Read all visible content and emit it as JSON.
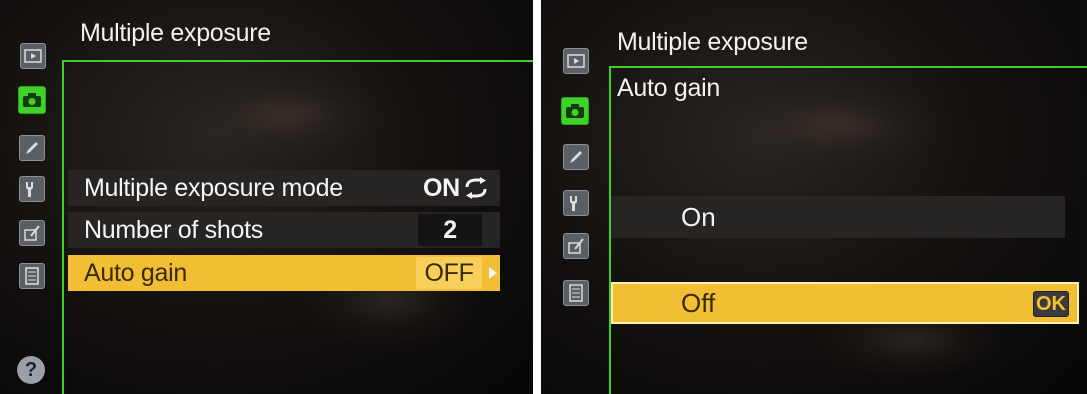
{
  "left_screen": {
    "title": "Multiple exposure",
    "rows": [
      {
        "label": "Multiple exposure mode",
        "value": "ON",
        "value_icon": "repeat-arrows-icon"
      },
      {
        "label": "Number of shots",
        "value": "2"
      },
      {
        "label": "Auto gain",
        "value": "OFF",
        "value_icon": "triangle-right-icon"
      }
    ],
    "sidebar_icons": [
      "playback-icon",
      "camera-icon",
      "pencil-icon",
      "wrench-icon",
      "retouch-icon",
      "menu-list-icon",
      "help-icon"
    ],
    "help_label": "?"
  },
  "right_screen": {
    "title": "Multiple exposure",
    "subtitle": "Auto gain",
    "options": [
      {
        "label": "On"
      },
      {
        "label": "Off",
        "badge": "OK"
      }
    ],
    "sidebar_icons": [
      "playback-icon",
      "camera-icon",
      "pencil-icon",
      "wrench-icon",
      "retouch-icon",
      "menu-list-icon"
    ]
  },
  "colors": {
    "accent_green": "#3fcf2a",
    "highlight_yellow": "#f2be34",
    "row_dark": "#262524"
  }
}
